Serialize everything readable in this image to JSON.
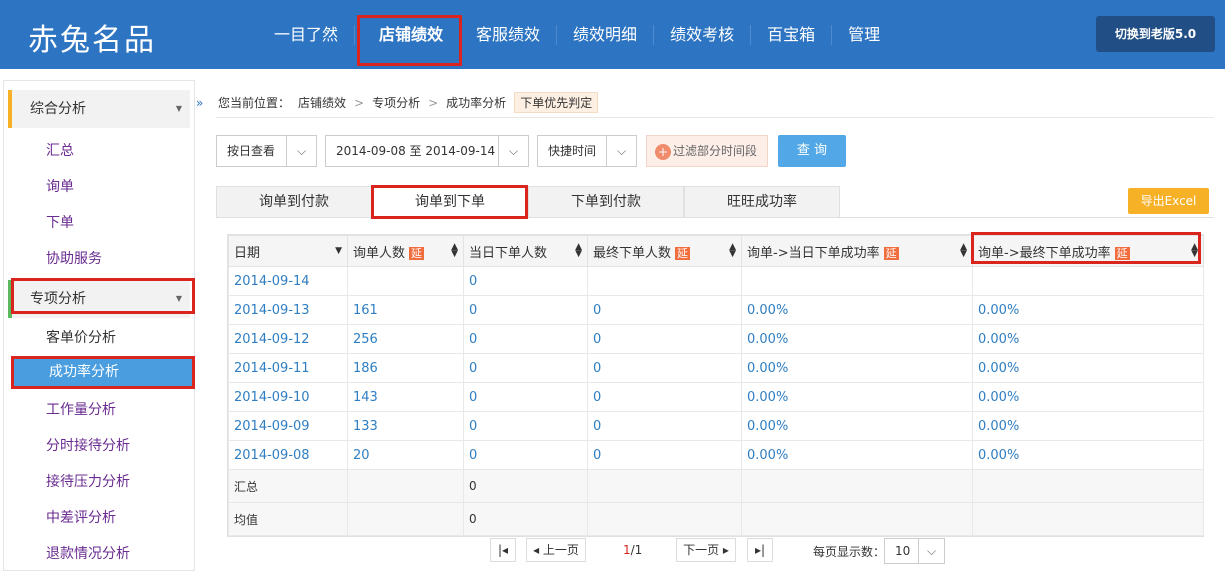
{
  "header": {
    "logo": "赤兔名品",
    "nav": [
      "一目了然",
      "店铺绩效",
      "客服绩效",
      "绩效明细",
      "绩效考核",
      "百宝箱",
      "管理"
    ],
    "switch_label": "切换到老版5.0"
  },
  "sidebar": {
    "group1": "综合分析",
    "group1_items": [
      "汇总",
      "询单",
      "下单",
      "协助服务"
    ],
    "group2": "专项分析",
    "group2_items": [
      "客单价分析",
      "成功率分析",
      "工作量分析",
      "分时接待分析",
      "接待压力分析",
      "中差评分析",
      "退款情况分析"
    ],
    "collapse": "»"
  },
  "breadcrumb": {
    "prefix": "您当前位置：",
    "path": [
      "店铺绩效",
      "专项分析",
      "成功率分析"
    ],
    "tag": "下单优先判定"
  },
  "filters": {
    "view_mode": "按日查看",
    "date_range": "2014-09-08 至 2014-09-14",
    "quick_time": "快捷时间",
    "filter_label": "过滤部分时间段",
    "query_label": "查 询"
  },
  "tabs": [
    "询单到付款",
    "询单到下单",
    "下单到付款",
    "旺旺成功率"
  ],
  "export_label": "导出Excel",
  "table": {
    "columns": [
      {
        "label": "日期",
        "ext": ""
      },
      {
        "label": "询单人数",
        "ext": "延"
      },
      {
        "label": "当日下单人数",
        "ext": ""
      },
      {
        "label": "最终下单人数",
        "ext": "延"
      },
      {
        "label": "询单->当日下单成功率",
        "ext": "延"
      },
      {
        "label": "询单->最终下单成功率",
        "ext": "延"
      }
    ],
    "rows": [
      [
        "2014-09-14",
        "",
        "0",
        "",
        "",
        ""
      ],
      [
        "2014-09-13",
        "161",
        "0",
        "0",
        "0.00%",
        "0.00%"
      ],
      [
        "2014-09-12",
        "256",
        "0",
        "0",
        "0.00%",
        "0.00%"
      ],
      [
        "2014-09-11",
        "186",
        "0",
        "0",
        "0.00%",
        "0.00%"
      ],
      [
        "2014-09-10",
        "143",
        "0",
        "0",
        "0.00%",
        "0.00%"
      ],
      [
        "2014-09-09",
        "133",
        "0",
        "0",
        "0.00%",
        "0.00%"
      ],
      [
        "2014-09-08",
        "20",
        "0",
        "0",
        "0.00%",
        "0.00%"
      ]
    ],
    "summary": [
      [
        "汇总",
        "",
        "0",
        "",
        "",
        ""
      ],
      [
        "均值",
        "",
        "0",
        "",
        "",
        ""
      ]
    ]
  },
  "pager": {
    "first": "|◂",
    "prev": "◂ 上一页",
    "current": "1",
    "total": "/1",
    "next": "下一页 ▸",
    "last": "▸|",
    "page_size_label": "每页显示数：",
    "page_size": "10"
  }
}
